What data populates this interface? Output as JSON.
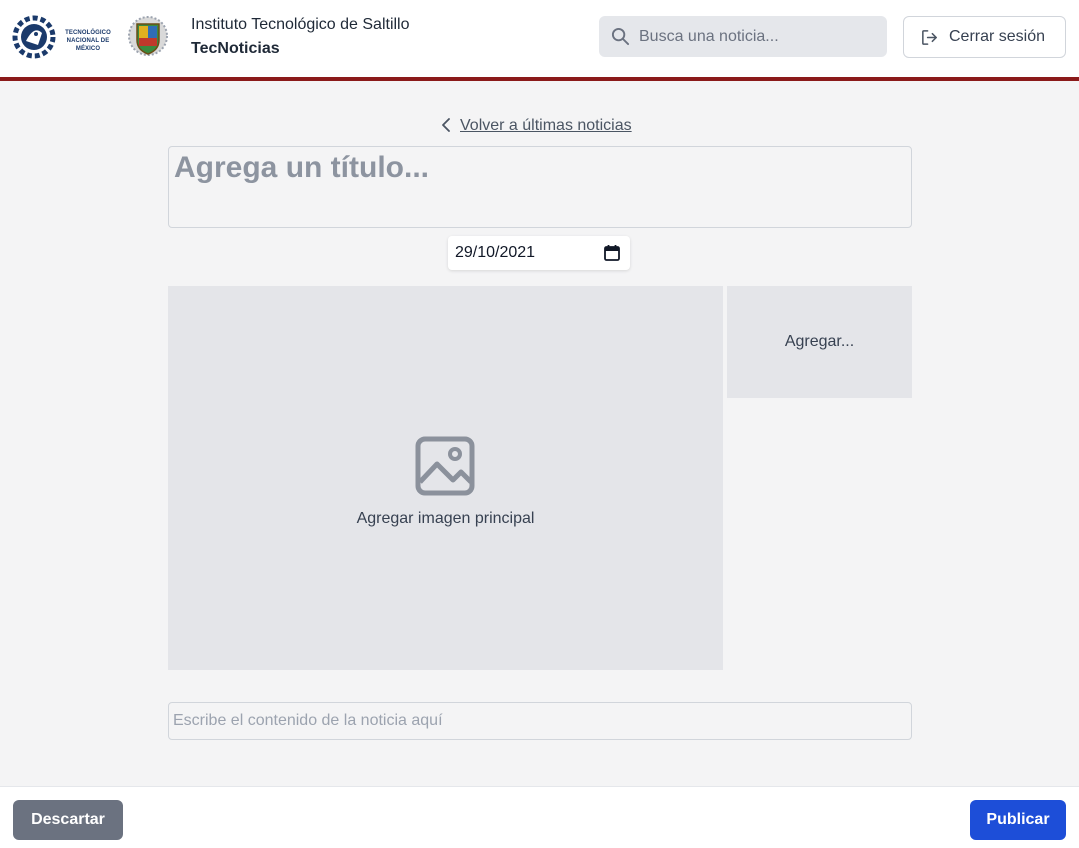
{
  "header": {
    "tecnm_logo_text": "TECNOLÓGICO NACIONAL DE MÉXICO",
    "institution_name": "Instituto Tecnológico de Saltillo",
    "app_name": "TecNoticias",
    "search": {
      "placeholder": "Busca una noticia...",
      "value": ""
    },
    "logout_label": "Cerrar sesión",
    "accent_color": "#8b1a1a"
  },
  "editor": {
    "back_link_label": "Volver a últimas noticias",
    "title_placeholder": "Agrega un título...",
    "date_value": "29/10/2021",
    "main_image_label": "Agregar imagen principal",
    "side_add_label": "Agregar...",
    "content_placeholder": "Escribe el contenido de la noticia aquí"
  },
  "footer": {
    "discard_label": "Descartar",
    "publish_label": "Publicar",
    "publish_color": "#1d4ed8",
    "discard_color": "#6b7280"
  },
  "icons": {
    "search": "search-icon",
    "logout": "logout-icon",
    "back": "chevron-left-icon",
    "calendar": "calendar-icon",
    "image": "image-icon"
  }
}
